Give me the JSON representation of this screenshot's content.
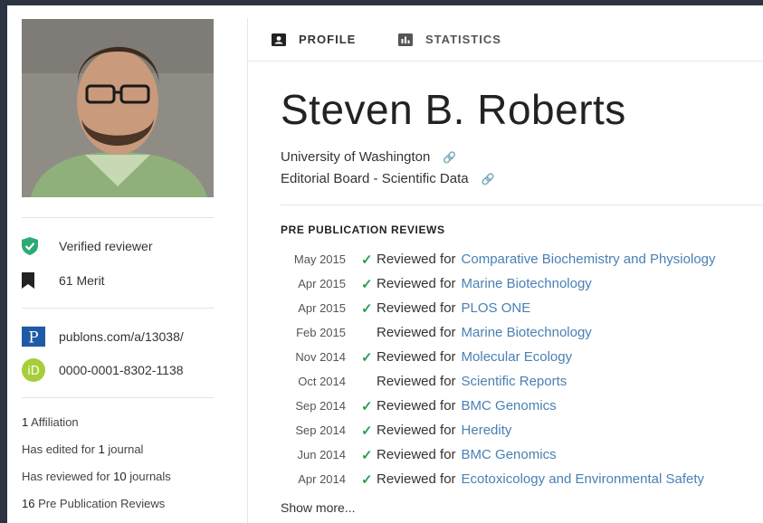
{
  "tabs": {
    "profile": "PROFILE",
    "statistics": "STATISTICS"
  },
  "profile": {
    "name": "Steven B. Roberts",
    "affiliations": [
      "University of Washington",
      "Editorial Board - Scientific Data"
    ]
  },
  "sidebar": {
    "verified": "Verified reviewer",
    "merit": "61 Merit",
    "publons_url": "publons.com/a/13038/",
    "orcid": "0000-0001-8302-1138",
    "stats": {
      "affiliation_count": "1",
      "affiliation_label": "Affiliation",
      "edited_prefix": "Has edited for",
      "edited_count": "1",
      "edited_suffix": "journal",
      "reviewed_prefix": "Has reviewed for",
      "reviewed_count": "10",
      "reviewed_suffix": "journals",
      "prepub_count": "16",
      "prepub_label": "Pre Publication Reviews"
    }
  },
  "reviews": {
    "title": "PRE PUBLICATION REVIEWS",
    "prefix": "Reviewed for",
    "items": [
      {
        "date": "May 2015",
        "verified": true,
        "journal": "Comparative Biochemistry and Physiology"
      },
      {
        "date": "Apr 2015",
        "verified": true,
        "journal": "Marine Biotechnology"
      },
      {
        "date": "Apr 2015",
        "verified": true,
        "journal": "PLOS ONE"
      },
      {
        "date": "Feb 2015",
        "verified": false,
        "journal": "Marine Biotechnology"
      },
      {
        "date": "Nov 2014",
        "verified": true,
        "journal": "Molecular Ecology"
      },
      {
        "date": "Oct 2014",
        "verified": false,
        "journal": "Scientific Reports"
      },
      {
        "date": "Sep 2014",
        "verified": true,
        "journal": "BMC Genomics"
      },
      {
        "date": "Sep 2014",
        "verified": true,
        "journal": "Heredity"
      },
      {
        "date": "Jun 2014",
        "verified": true,
        "journal": "BMC Genomics"
      },
      {
        "date": "Apr 2014",
        "verified": true,
        "journal": "Ecotoxicology and Environmental Safety"
      }
    ],
    "show_more": "Show more..."
  },
  "colors": {
    "link": "#4a80b4",
    "check": "#2e9e52",
    "verified_badge": "#2eaa73",
    "publons": "#1f5aa6",
    "orcid": "#a6ce39"
  }
}
